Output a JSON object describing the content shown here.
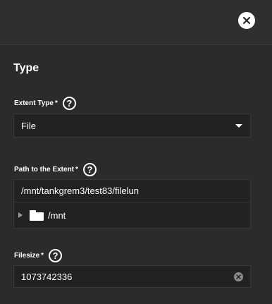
{
  "section": {
    "title": "Type"
  },
  "extent_type": {
    "label": "Extent Type",
    "required_mark": "*",
    "help_glyph": "?",
    "selected_value": "File"
  },
  "path": {
    "label": "Path to the Extent",
    "required_mark": "*",
    "help_glyph": "?",
    "value": "/mnt/tankgrem3/test83/filelun",
    "tree": {
      "root_label": "/mnt"
    }
  },
  "filesize": {
    "label": "Filesize",
    "required_mark": "*",
    "help_glyph": "?",
    "value": "1073742336"
  },
  "icons": {
    "close": "close-icon",
    "help": "help-icon",
    "folder": "folder-icon",
    "expand": "chevron-right-icon",
    "dropdown": "chevron-down-icon",
    "clear": "clear-icon"
  },
  "colors": {
    "background": "#2b2b2b",
    "input_background": "#222222",
    "text": "#ffffff"
  }
}
